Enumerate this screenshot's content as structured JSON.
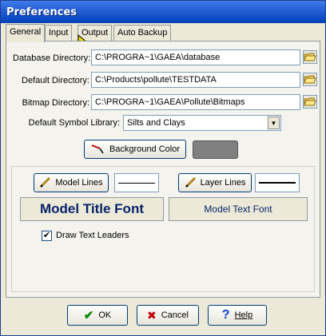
{
  "window": {
    "title": "Preferences"
  },
  "tabs": [
    {
      "label": "General",
      "active": true
    },
    {
      "label": "Input",
      "active": false
    },
    {
      "label": "Output",
      "active": false
    },
    {
      "label": "Auto Backup",
      "active": false
    }
  ],
  "directories": {
    "database": {
      "label": "Database Directory:",
      "value": "C:\\PROGRA~1\\GAEA\\database"
    },
    "default": {
      "label": "Default Directory:",
      "value": "C:\\Products\\pollute\\TESTDATA"
    },
    "bitmap": {
      "label": "Bitmap Directory:",
      "value": "C:\\PROGRA~1\\GAEA\\Pollute\\Bitmaps"
    }
  },
  "symbol_library": {
    "label": "Default Symbol Library:",
    "value": "Silts and Clays"
  },
  "background": {
    "button_label": "Background Color",
    "swatch_color": "#808080"
  },
  "model_lines": {
    "button_label": "Model Lines"
  },
  "layer_lines": {
    "button_label": "Layer Lines"
  },
  "fonts": {
    "title_font_label": "Model Title Font",
    "text_font_label": "Model Text Font"
  },
  "leaders": {
    "label": "Draw Text Leaders",
    "checked": true,
    "check_glyph": "✔"
  },
  "buttons": {
    "ok": "OK",
    "cancel": "Cancel",
    "help": "Help"
  },
  "icons": {
    "ok": "check-icon",
    "cancel": "x-icon",
    "help": "question-icon",
    "browse": "folder-icon",
    "pen": "pencil-icon",
    "dropdown": "chevron-down-icon"
  },
  "glyphs": {
    "dropdown": "▼",
    "help": "?",
    "cancel": "✖",
    "ok": "✔"
  }
}
